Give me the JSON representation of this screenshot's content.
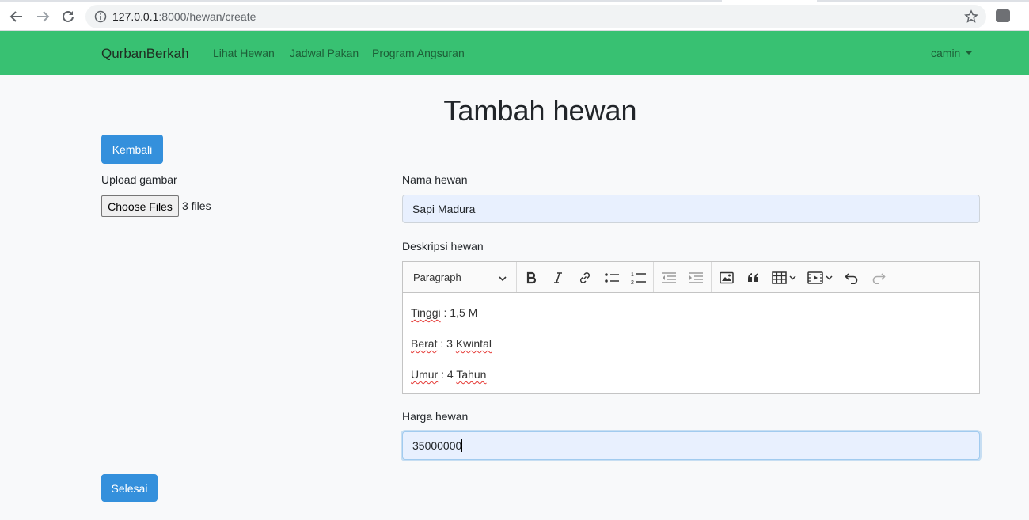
{
  "browser": {
    "url_host": "127.0.0.1",
    "url_path": ":8000/hewan/create"
  },
  "navbar": {
    "brand": "QurbanBerkah",
    "links": [
      "Lihat Hewan",
      "Jadwal Pakan",
      "Program Angsuran"
    ],
    "user": "camin",
    "bg_color": "#38c172"
  },
  "page": {
    "title": "Tambah hewan",
    "back_button": "Kembali",
    "submit_button": "Selesai"
  },
  "form": {
    "upload_label": "Upload gambar",
    "file_button": "Choose Files",
    "file_status": "3 files",
    "name_label": "Nama hewan",
    "name_value": "Sapi Madura",
    "desc_label": "Deskripsi hewan",
    "heading_select": "Paragraph",
    "desc_lines": [
      {
        "key": "Tinggi",
        "rest": " : 1,5 M",
        "sq2": ""
      },
      {
        "key": "Berat",
        "rest": " : 3 ",
        "sq2": "Kwintal"
      },
      {
        "key": "Umur",
        "rest": " : 4 ",
        "sq2": "Tahun"
      }
    ],
    "price_label": "Harga hewan",
    "price_value": "35000000"
  },
  "toolbar_icons": [
    "bold-icon",
    "italic-icon",
    "link-icon",
    "bulleted-list-icon",
    "numbered-list-icon",
    "outdent-icon",
    "indent-icon",
    "image-icon",
    "blockquote-icon",
    "table-icon",
    "media-icon",
    "undo-icon",
    "redo-icon"
  ]
}
